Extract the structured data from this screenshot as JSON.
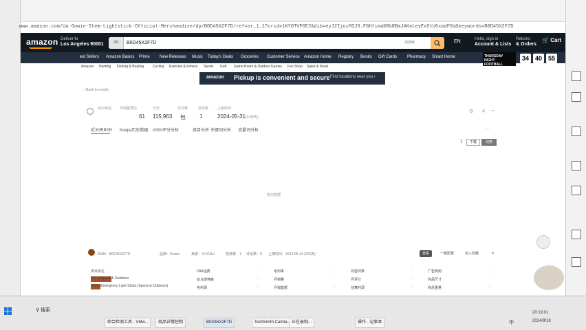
{
  "browser": {
    "url": "www.amazon.com/Ua-Gowin-Item-Lightstick-Official-Merchandise/dp/B0D45X2F7D/ref=sr_1_1?crid=1KY0TVF0E2&dib=eyJ2IjoiMSJ9.FGHfimaKRkRBmJAKoLeyEx5tU6xadF0d&keywords=B0D45X2F7D"
  },
  "amazon": {
    "logo": "amazon",
    "deliver_to": "Deliver to",
    "location": "Los Angeles 90001",
    "search_category": "All",
    "search_value": "B0D45X2F7D",
    "search_hint": "用搜索",
    "lang": "EN",
    "signin_line1": "Hello, sign in",
    "signin_line2": "Account & Lists",
    "returns_line1": "Returns",
    "returns_line2": "& Orders",
    "cart": "Cart",
    "nav": [
      "est Sellers",
      "Amazon Basics",
      "Prime",
      "New Releases",
      "Music",
      "Today's Deals",
      "Groceries",
      "Customer Service",
      "Amazon Home",
      "Registry",
      "Books",
      "Gift Cards",
      "Pharmacy",
      "Smart Home"
    ],
    "promo": "THURSDAY NIGHT FOOTBALL",
    "timer": [
      "34",
      "40",
      "55"
    ],
    "catnav": [
      "Amazon",
      "Hunting",
      "Fishing & Boating",
      "Cycling",
      "Exercise & Fitness",
      "Sports",
      "Golf",
      "Game Room & Outdoor Games",
      "Fan Shop",
      "Sales & Deals"
    ],
    "banner_logo": "amazon",
    "banner_text": "Pickup is convenient and secure",
    "banner_btn": "Find locations near you ›",
    "back": "‹ Back to results"
  },
  "plugin": {
    "stats_labels": [
      "BSR排名",
      "月销量预估",
      "评分",
      "评分数",
      "变体数",
      "上架时间"
    ],
    "stats_values": [
      "61",
      "115,963",
      "包",
      "1",
      "2024-05-31",
      "(106天)"
    ],
    "tabs": [
      "近30天BSR",
      "Keepa历史数据",
      "ASIN评分分析",
      "类目分析",
      "关键词分析",
      "流量词分析"
    ],
    "export": "下载",
    "toggle_on": "切换",
    "empty": "暂无数据",
    "info": [
      "ASIN：B0D45X2F7D",
      "品牌：Gowin",
      "卖家：YUYUIU",
      "变体数：1",
      "评论数：0",
      "上架时间：2024-05-14 (126天)"
    ],
    "buttons": [
      "查看",
      "一键配置",
      "加入收藏"
    ],
    "category_title": "类目排名",
    "categories": [
      "#1 in Sports & Outdoors",
      "#1 in Emergency Light Sticks (Sports & Outdoors)"
    ],
    "grid_labels": [
      "FBA运费",
      "亚马逊佣金",
      "毛利润",
      "毛利率",
      "月销量",
      "月销售额",
      "月留评数",
      "月评分",
      "估算利润",
      "广告费用",
      "商品尺寸",
      "商品重量"
    ]
  },
  "taskbar": {
    "search": "搜索",
    "apps": [
      "综合检测工具 - VMw...",
      "商品详情控制",
      "B0D45X2F7D",
      "TechSmith Camta...",
      "正在录制...",
      "操作 - 记事本"
    ],
    "time": "20:19:01",
    "date": "2024/9/18",
    "tray_label": "中"
  }
}
